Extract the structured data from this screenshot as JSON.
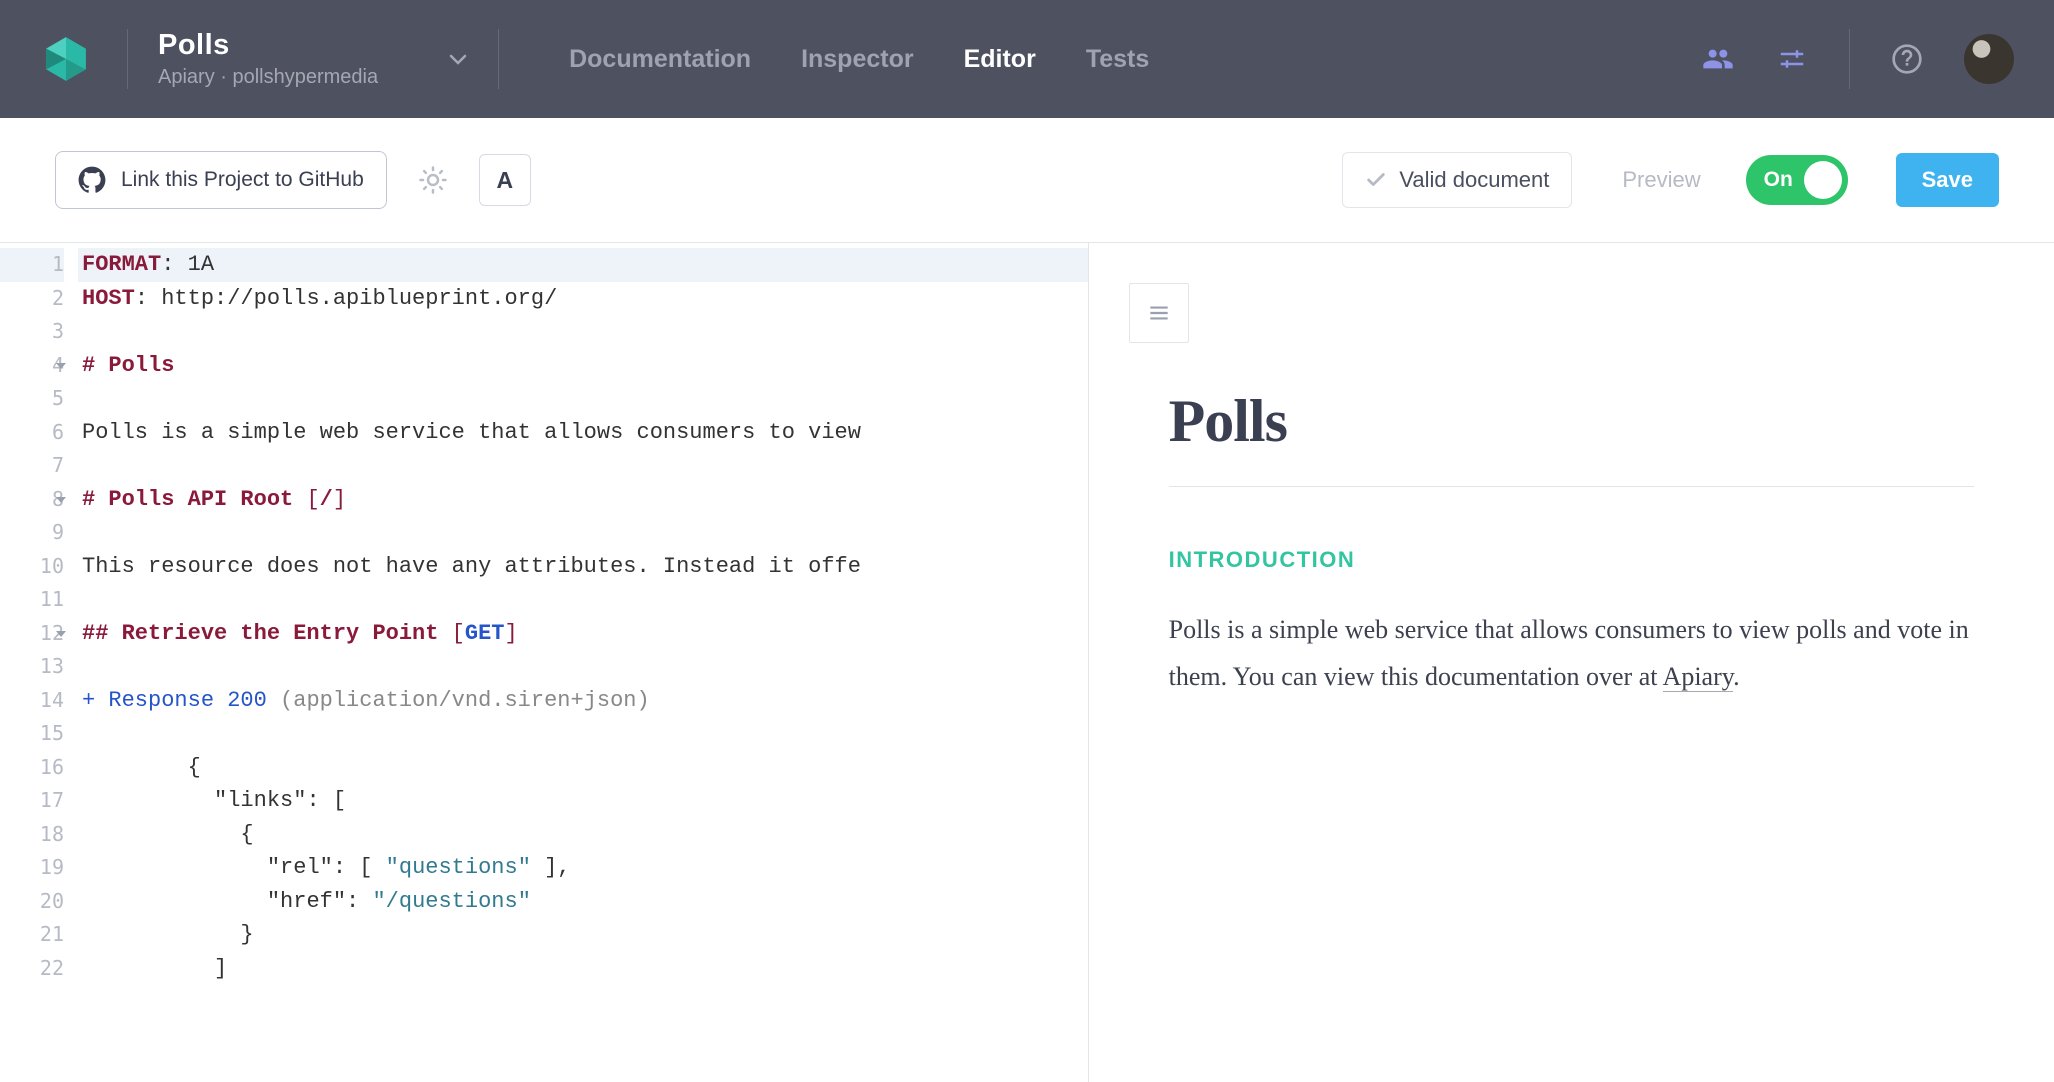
{
  "header": {
    "title": "Polls",
    "subtitle": "Apiary · pollshypermedia",
    "nav": [
      "Documentation",
      "Inspector",
      "Editor",
      "Tests"
    ],
    "active_nav_index": 2
  },
  "toolbar": {
    "link_button": "Link this Project to GitHub",
    "format_button": "A",
    "valid_label": "Valid document",
    "preview_label": "Preview",
    "toggle_label": "On",
    "save_label": "Save"
  },
  "editor": {
    "line_count": 22,
    "active_line": 1,
    "fold_lines": [
      4,
      8,
      12
    ],
    "code_tokens": [
      [
        {
          "t": "FORMAT",
          "c": "kw"
        },
        {
          "t": ": ",
          "c": ""
        },
        {
          "t": "1A",
          "c": ""
        }
      ],
      [
        {
          "t": "HOST",
          "c": "kw"
        },
        {
          "t": ": ",
          "c": ""
        },
        {
          "t": "http://polls.apiblueprint.org/",
          "c": ""
        }
      ],
      [],
      [
        {
          "t": "# Polls",
          "c": "sec"
        }
      ],
      [],
      [
        {
          "t": "Polls is a simple web service that allows consumers to view",
          "c": ""
        }
      ],
      [],
      [
        {
          "t": "# Polls API Root ",
          "c": "sec"
        },
        {
          "t": "[",
          "c": "bracket"
        },
        {
          "t": "/",
          "c": "sec"
        },
        {
          "t": "]",
          "c": "bracket"
        }
      ],
      [],
      [
        {
          "t": "This resource does not have any attributes. Instead it offe",
          "c": ""
        }
      ],
      [],
      [
        {
          "t": "## Retrieve the Entry Point ",
          "c": "sec"
        },
        {
          "t": "[",
          "c": "bracket"
        },
        {
          "t": "GET",
          "c": "method"
        },
        {
          "t": "]",
          "c": "bracket"
        }
      ],
      [],
      [
        {
          "t": "+",
          "c": "plus"
        },
        {
          "t": " Response ",
          "c": "resp"
        },
        {
          "t": "200",
          "c": "num"
        },
        {
          "t": " (application/vnd.siren+json)",
          "c": "cmnt"
        }
      ],
      [],
      [
        {
          "t": "        ",
          "c": "indent-guide"
        },
        {
          "t": "{",
          "c": ""
        }
      ],
      [
        {
          "t": "        ",
          "c": "indent-guide"
        },
        {
          "t": "  \"links\": [",
          "c": ""
        }
      ],
      [
        {
          "t": "        ",
          "c": "indent-guide"
        },
        {
          "t": "    {",
          "c": ""
        }
      ],
      [
        {
          "t": "        ",
          "c": "indent-guide"
        },
        {
          "t": "      \"rel\": [ ",
          "c": ""
        },
        {
          "t": "\"questions\"",
          "c": "str"
        },
        {
          "t": " ],",
          "c": ""
        }
      ],
      [
        {
          "t": "        ",
          "c": "indent-guide"
        },
        {
          "t": "      \"href\": ",
          "c": ""
        },
        {
          "t": "\"/questions\"",
          "c": "str"
        }
      ],
      [
        {
          "t": "        ",
          "c": "indent-guide"
        },
        {
          "t": "    }",
          "c": ""
        }
      ],
      [
        {
          "t": "        ",
          "c": "indent-guide"
        },
        {
          "t": "  ]",
          "c": ""
        }
      ]
    ]
  },
  "preview": {
    "title": "Polls",
    "section": "INTRODUCTION",
    "desc_html": "Polls is a simple web service that allows consumers to view polls and vote in them. You can view this documentation over at <a href='#'>Apiary</a>."
  }
}
